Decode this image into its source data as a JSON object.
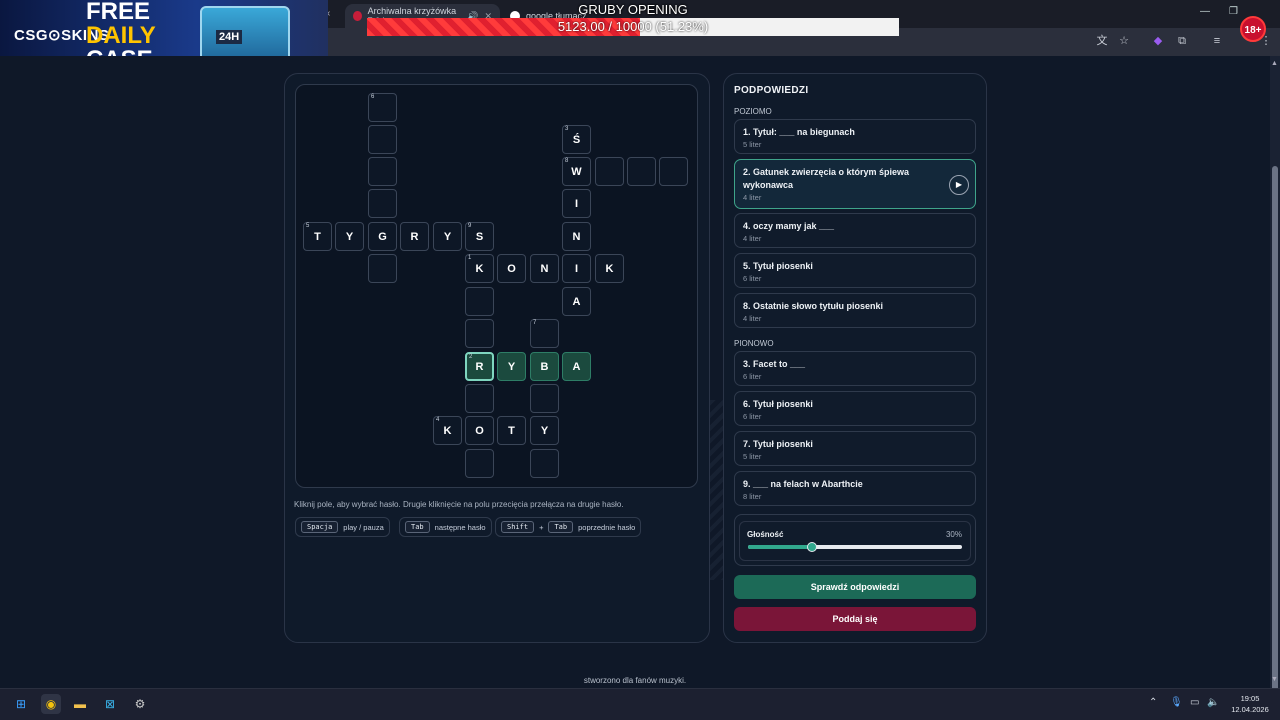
{
  "browser": {
    "tabs": [
      {
        "title": "Archiwalna krzyżówka 7.04",
        "active": true
      },
      {
        "title": "google tłumacz",
        "active": false
      }
    ]
  },
  "overlay": {
    "promo_brand": "CSG⊙SKINS",
    "promo_free": "FREE",
    "promo_daily": "DAILY",
    "promo_case": "CASE",
    "promo_timer": "24H",
    "progress_title": "GRUBY OPENING",
    "progress_text": "5123.00 / 10000 (51.23%)",
    "progress_fraction": 0.5123,
    "age_badge": "18+"
  },
  "crossword": {
    "cells": [
      {
        "num": "6",
        "letter": ""
      },
      {
        "num": "",
        "letter": ""
      },
      {
        "num": "",
        "letter": ""
      },
      {
        "num": "",
        "letter": ""
      },
      {
        "num": "5",
        "letter": "T"
      },
      {
        "num": "",
        "letter": "Y"
      },
      {
        "num": "",
        "letter": "G"
      },
      {
        "num": "",
        "letter": "R"
      },
      {
        "num": "",
        "letter": "Y"
      },
      {
        "num": "9",
        "letter": "S"
      },
      {
        "num": "",
        "letter": ""
      },
      {
        "num": "3",
        "letter": "Ś"
      },
      {
        "num": "8",
        "letter": "W"
      },
      {
        "num": "",
        "letter": ""
      },
      {
        "num": "",
        "letter": ""
      },
      {
        "num": "",
        "letter": ""
      },
      {
        "num": "",
        "letter": "I"
      },
      {
        "num": "",
        "letter": "N"
      },
      {
        "num": "1",
        "letter": "K"
      },
      {
        "num": "",
        "letter": "O"
      },
      {
        "num": "",
        "letter": "N"
      },
      {
        "num": "",
        "letter": "I"
      },
      {
        "num": "",
        "letter": "K"
      },
      {
        "num": "",
        "letter": "A"
      },
      {
        "num": "",
        "letter": ""
      },
      {
        "num": "",
        "letter": ""
      },
      {
        "num": "7",
        "letter": ""
      },
      {
        "num": "2",
        "letter": "R"
      },
      {
        "num": "",
        "letter": "Y"
      },
      {
        "num": "",
        "letter": "B"
      },
      {
        "num": "",
        "letter": "A"
      },
      {
        "num": "",
        "letter": ""
      },
      {
        "num": "",
        "letter": ""
      },
      {
        "num": "4",
        "letter": "K"
      },
      {
        "num": "",
        "letter": "O"
      },
      {
        "num": "",
        "letter": "T"
      },
      {
        "num": "",
        "letter": "Y"
      },
      {
        "num": "",
        "letter": ""
      },
      {
        "num": "",
        "letter": ""
      }
    ],
    "hint": "Kliknij pole, aby wybrać hasło. Drugie kliknięcie na polu przecięcia przełącza na drugie hasło.",
    "shortcuts": [
      {
        "keys": [
          "Spacja"
        ],
        "label": "play / pauza"
      },
      {
        "keys": [
          "Tab"
        ],
        "label": "następne hasło"
      },
      {
        "keys": [
          "Shift",
          "Tab"
        ],
        "label": "poprzednie hasło",
        "joiner": "+"
      }
    ]
  },
  "clues": {
    "title": "PODPOWIEDZI",
    "across_label": "POZIOMO",
    "down_label": "PIONOWO",
    "across": [
      {
        "text": "1. Tytuł: ___ na biegunach",
        "sub": "5 liter"
      },
      {
        "text": "2. Gatunek zwierzęcia o którym śpiewa wykonawca",
        "sub": "4 liter",
        "active": true
      },
      {
        "text": "4. oczy mamy jak ___",
        "sub": "4 liter"
      },
      {
        "text": "5. Tytuł piosenki",
        "sub": "6 liter"
      },
      {
        "text": "8. Ostatnie słowo tytułu piosenki",
        "sub": "4 liter"
      }
    ],
    "down": [
      {
        "text": "3. Facet to ___",
        "sub": "6 liter"
      },
      {
        "text": "6. Tytuł piosenki",
        "sub": "6 liter"
      },
      {
        "text": "7. Tytuł piosenki",
        "sub": "5 liter"
      },
      {
        "text": "9. ___ na felach w Abarthcie",
        "sub": "8 liter"
      }
    ],
    "volume_label": "Głośność",
    "volume_value": "30%",
    "volume_fraction": 0.3,
    "check_button": "Sprawdź odpowiedzi",
    "give_up_button": "Poddaj się"
  },
  "footer": "stworzono dla fanów muzyki.",
  "taskbar": {
    "time": "19:05",
    "date": "12.04.2026"
  }
}
